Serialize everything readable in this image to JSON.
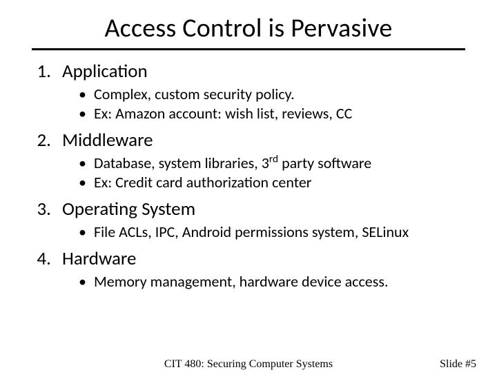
{
  "title": "Access Control is Pervasive",
  "items": [
    {
      "label": "Application",
      "sub": [
        "Complex, custom security policy.",
        "Ex: Amazon account: wish list, reviews, CC"
      ]
    },
    {
      "label": "Middleware",
      "sub": [
        "Database, system libraries, 3<sup>rd</sup> party software",
        "Ex: Credit card authorization center"
      ]
    },
    {
      "label": "Operating System",
      "sub": [
        "File ACLs, IPC, Android permissions system, SELinux"
      ]
    },
    {
      "label": "Hardware",
      "sub": [
        "Memory management, hardware device access."
      ]
    }
  ],
  "footer": {
    "center": "CIT 480: Securing Computer Systems",
    "right": "Slide #5"
  },
  "bullet_glyph": "•"
}
